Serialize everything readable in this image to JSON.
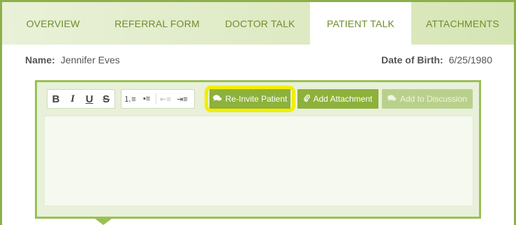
{
  "tabs": {
    "overview": "OVERVIEW",
    "referral_form": "REFERRAL FORM",
    "doctor_talk": "DOCTOR TALK",
    "patient_talk": "PATIENT TALK",
    "attachments": "ATTACHMENTS",
    "active": "patient_talk"
  },
  "patient": {
    "name_label": "Name:",
    "name_value": "Jennifer Eves",
    "dob_label": "Date of Birth:",
    "dob_value": "6/25/1980"
  },
  "toolbar": {
    "bold": "B",
    "italic": "I",
    "underline": "U",
    "strike": "S",
    "ordered_list": "⒈≡",
    "unordered_list": "•≡",
    "outdent": "⇤≡",
    "indent": "⇥≡",
    "reinvite_label": "Re-Invite Patient",
    "attach_label": "Add Attachment",
    "discuss_label": "Add to Discussion"
  },
  "colors": {
    "brand_green": "#8db13b",
    "highlight_yellow": "#f2ee00"
  },
  "icons": {
    "reinvite": "chat-bubbles-icon",
    "attach": "paperclip-icon",
    "discuss": "chat-bubbles-icon"
  }
}
